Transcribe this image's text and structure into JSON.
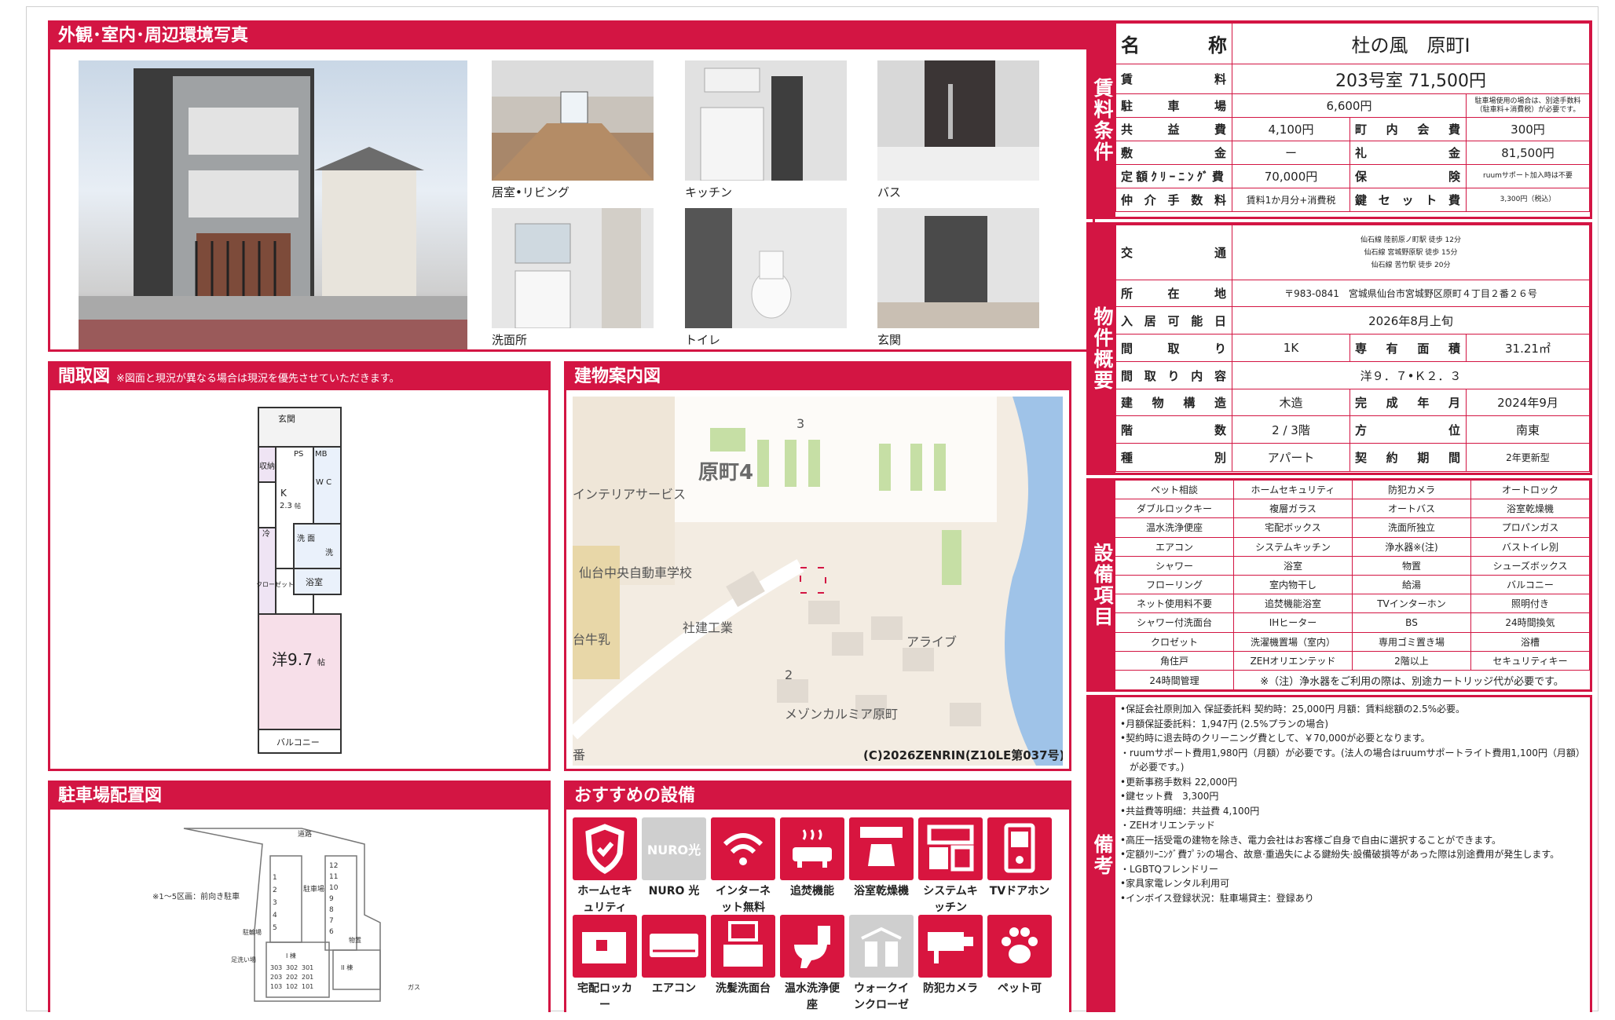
{
  "photos": {
    "title": "外観･室内･周辺環境写真",
    "captions": [
      "居室•リビング",
      "キッチン",
      "バス",
      "洗面所",
      "トイレ",
      "玄関"
    ]
  },
  "floorplan": {
    "title": "間取図",
    "note": "※図面と現況が異なる場合は現況を優先させていただきます。",
    "rooms": {
      "entrance": "玄関",
      "storage": "収納",
      "ps": "PS",
      "mb": "MB",
      "kitchen": "K",
      "kitchen_size": "2.3",
      "kitchen_unit": "帖",
      "wc": "W\nC",
      "fridge": "冷",
      "closet": "クローゼット",
      "washroom": "洗\n面",
      "washer": "洗",
      "bath": "浴室",
      "living": "洋9.7",
      "living_unit": "帖",
      "balcony": "バルコニー"
    }
  },
  "map": {
    "title": "建物案内図",
    "labels": {
      "area": "原町4",
      "block3": "3",
      "block2": "2",
      "interior": "インテリアサービス",
      "school": "仙台中央自動車学校",
      "shaken": "社建工業",
      "alive": "アライブ",
      "milk": "台牛乳",
      "mansion": "メゾンカルミア原町",
      "bottom": "番",
      "copyright": "(C)2026ZENRIN(Z10LE第037号)"
    }
  },
  "parking": {
    "title": "駐車場配置図",
    "note": "※1～5区画：前向き駐車",
    "labels": {
      "road": "道路",
      "lot": "駐車場",
      "bike": "駐輪場",
      "feet": "足洗い場",
      "storage": "物置",
      "gas": "ガス",
      "rooms": [
        "303",
        "302",
        "301",
        "203",
        "202",
        "201",
        "103",
        "102",
        "101"
      ],
      "col1": [
        "1",
        "2",
        "3",
        "4",
        "5"
      ],
      "col2": [
        "12",
        "11",
        "10",
        "9",
        "8",
        "7",
        "6"
      ],
      "bldg1": "I 棟",
      "bldg2": "II 棟"
    }
  },
  "recommended": {
    "title": "おすすめの設備",
    "items": [
      {
        "label": "ホームセキュリティ",
        "icon": "shield-icon"
      },
      {
        "label": "NURO 光",
        "icon": "nuro-icon",
        "tile": "NURO光"
      },
      {
        "label": "インターネット無料",
        "icon": "wifi-icon"
      },
      {
        "label": "追焚機能",
        "icon": "bathtub-icon"
      },
      {
        "label": "浴室乾燥機",
        "icon": "bath-dryer-icon"
      },
      {
        "label": "システムキッチン",
        "icon": "kitchen-icon"
      },
      {
        "label": "TVドアホン",
        "icon": "tv-doorphone-icon"
      },
      {
        "label": "宅配ロッカー",
        "icon": "locker-icon"
      },
      {
        "label": "エアコン",
        "icon": "aircon-icon"
      },
      {
        "label": "洗髪洗面台",
        "icon": "washbasin-icon"
      },
      {
        "label": "温水洗浄便座",
        "icon": "toilet-icon"
      },
      {
        "label": "ウォークインクローゼット",
        "icon": "closet-icon"
      },
      {
        "label": "防犯カメラ",
        "icon": "camera-icon"
      },
      {
        "label": "ペット可",
        "icon": "paw-icon"
      }
    ]
  },
  "rent": {
    "side": "賃料条件",
    "name_label": "名　　称",
    "name": "杜の風　原町Ⅰ",
    "rent_label": "賃　　料",
    "rent": "203号室 71,500円",
    "parking_label": "駐車場",
    "parking": "6,600円",
    "parking_note": "駐車場使用の場合は、別途手数料（駐車料+消費税）が必要です。",
    "common_label": "共益費",
    "common": "4,100円",
    "town_label": "町内会費",
    "town": "300円",
    "deposit_label": "敷金",
    "deposit": "ー",
    "keymoney_label": "礼金",
    "keymoney": "81,500円",
    "cleaning_label": "定額ｸﾘｰﾆﾝｸﾞ費",
    "cleaning": "70,000円",
    "insurance_label": "保険",
    "insurance": "ruumサポート加入時は不要",
    "brokerage_label": "仲介手数料",
    "brokerage": "賃料1か月分+消費税",
    "keyset_label": "鍵セット費",
    "keyset": "3,300円（税込）"
  },
  "property": {
    "side": "物件概要",
    "transport_label": "交　　通",
    "transport": [
      "仙石線 陸前原ノ町駅 徒歩 12分",
      "仙石線 宮城野原駅 徒歩 15分",
      "仙石線 苦竹駅 徒歩 20分"
    ],
    "address_label": "所在地",
    "address": "〒983-0841　宮城県仙台市宮城野区原町４丁目２番２６号",
    "movein_label": "入居可能日",
    "movein": "2026年8月上旬",
    "layout_label": "間取り",
    "layout": "1K",
    "area_label": "専有面積",
    "area": "31.21㎡",
    "detail_label": "間取り内容",
    "detail": "洋９．７•Ｋ２．３",
    "structure_label": "建物構造",
    "structure": "木造",
    "built_label": "完成年月",
    "built": "2024年9月",
    "floor_label": "階数",
    "floor": "2 / 3階",
    "direction_label": "方位",
    "direction": "南東",
    "type_label": "種別",
    "type": "アパート",
    "contract_label": "契約期間",
    "contract": "2年更新型"
  },
  "equipment": {
    "side": "設備項目",
    "items": [
      "ペット相談",
      "ホームセキュリティ",
      "防犯カメラ",
      "オートロック",
      "ダブルロックキー",
      "複層ガラス",
      "オートバス",
      "浴室乾燥機",
      "温水洗浄便座",
      "宅配ボックス",
      "洗面所独立",
      "プロパンガス",
      "エアコン",
      "システムキッチン",
      "浄水器※(注)",
      "バストイレ別",
      "シャワー",
      "浴室",
      "物置",
      "シューズボックス",
      "フローリング",
      "室内物干し",
      "給湯",
      "バルコニー",
      "ネット使用料不要",
      "追焚機能浴室",
      "TVインターホン",
      "照明付き",
      "シャワー付洗面台",
      "IHヒーター",
      "BS",
      "24時間換気",
      "クロゼット",
      "洗濯機置場（室内）",
      "専用ゴミ置き場",
      "浴槽",
      "角住戸",
      "ZEHオリエンテッド",
      "2階以上",
      "セキュリティキー"
    ],
    "last_item": "24時間管理",
    "last_note": "※（注）浄水器をご利用の際は、別途カートリッジ代が必要です。"
  },
  "remarks": {
    "side": "備考",
    "lines": [
      "•保証会社原則加入 保証委託料 契約時：25,000円 月額：賃料総額の2.5%必要。",
      "•月額保証委託料：1,947円 (2.5%プランの場合)",
      "•契約時に退去時のクリーニング費として、￥70,000が必要となります。",
      "・ruumサポート費用1,980円（月額）が必要です。(法人の場合はruumサポートライト費用1,100円（月額）",
      "　が必要です。)",
      "•更新事務手数料 22,000円",
      "•鍵セット費　3,300円",
      "•共益費等明細：共益費 4,100円",
      "・ZEHオリエンテッド",
      "•高圧一括受電の建物を除き、電力会社はお客様ご自身で自由に選択することができます。",
      "•定額ｸﾘｰﾆﾝｸﾞ費ﾌﾟﾗﾝの場合、故意·重過失による鍵紛失·設備破損等があった際は別途費用が発生します。",
      "・LGBTQフレンドリー",
      "•家具家電レンタル利用可",
      "•インボイス登録状況：駐車場貸主：登録あり"
    ]
  }
}
